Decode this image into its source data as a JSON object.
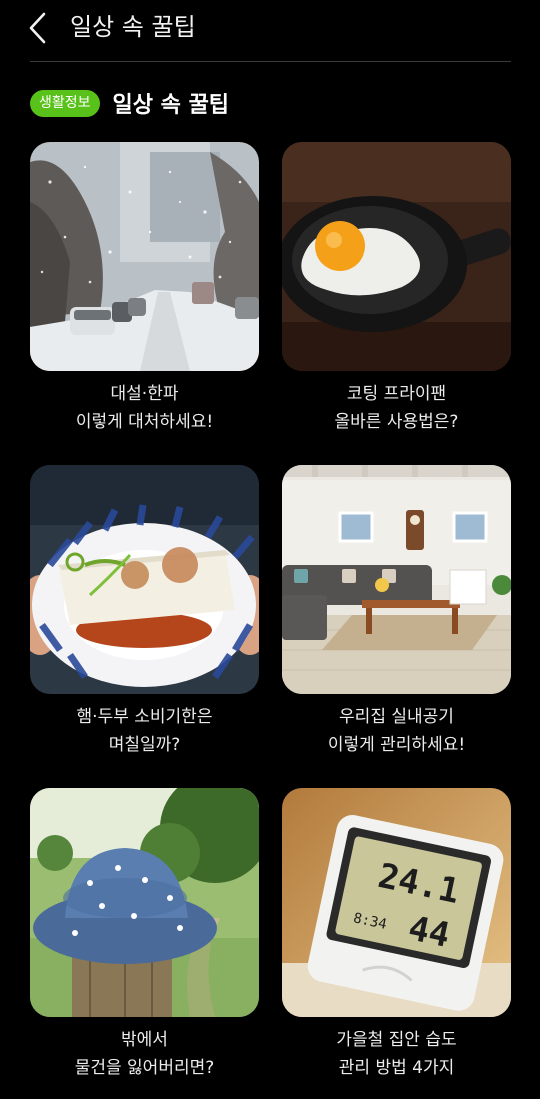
{
  "header": {
    "title": "일상 속 꿀팁"
  },
  "section": {
    "badge": "생활정보",
    "title": "일상 속 꿀팁"
  },
  "cards": [
    {
      "line1": "대설·한파",
      "line2": "이렇게 대처하세요!"
    },
    {
      "line1": "코팅 프라이팬",
      "line2": "올바른 사용법은?"
    },
    {
      "line1": "햄·두부 소비기한은",
      "line2": "며칠일까?"
    },
    {
      "line1": "우리집 실내공기",
      "line2": "이렇게 관리하세요!"
    },
    {
      "line1": "밖에서",
      "line2": "물건을 잃어버리면?"
    },
    {
      "line1": "가을철 집안 습도",
      "line2": "관리 방법 4가지"
    }
  ],
  "thermo": {
    "temp": "24.1",
    "small": "8:34",
    "humidity": "44"
  },
  "colors": {
    "badge": "#59c21a",
    "background": "#000000"
  }
}
